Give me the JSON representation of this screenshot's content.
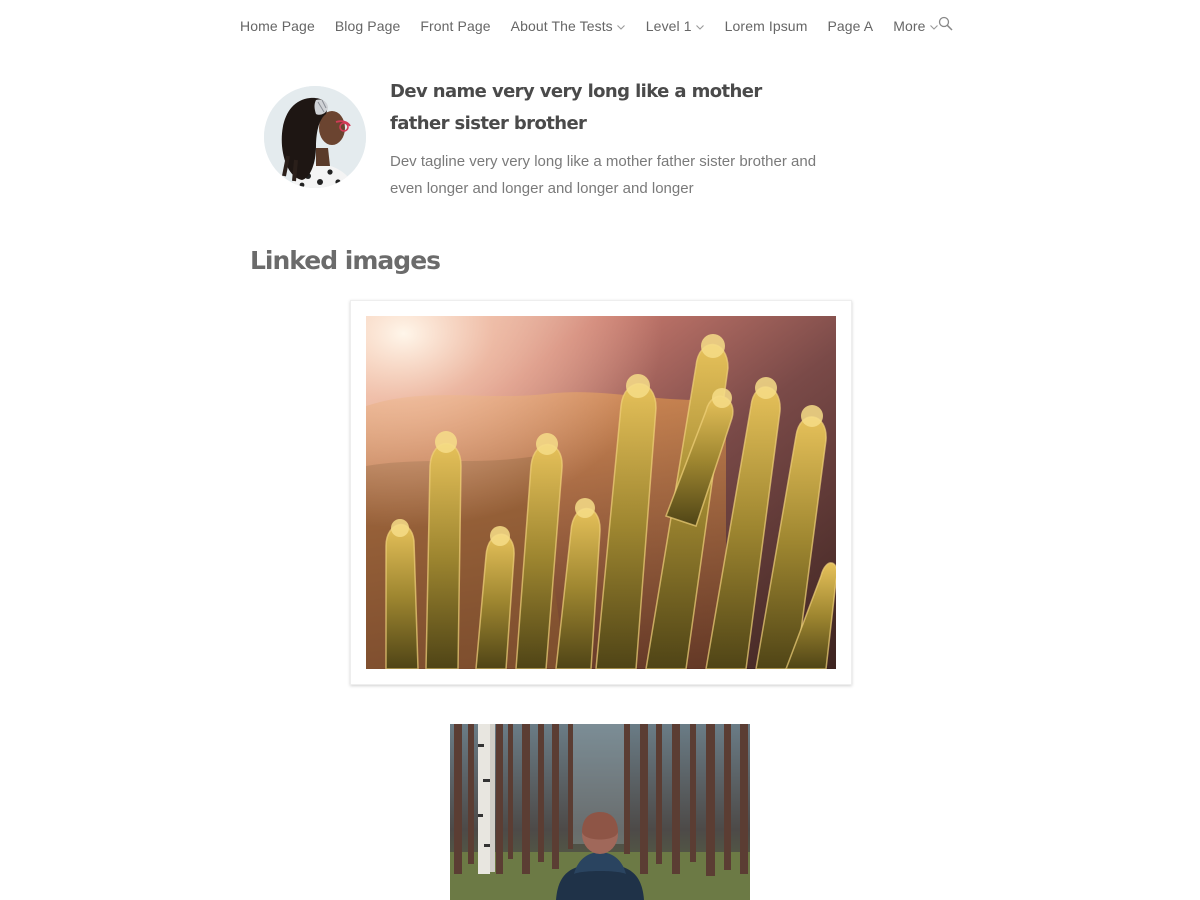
{
  "nav": {
    "items": [
      {
        "label": "Home Page",
        "has_dropdown": false
      },
      {
        "label": "Blog Page",
        "has_dropdown": false
      },
      {
        "label": "Front Page",
        "has_dropdown": false
      },
      {
        "label": "About The Tests",
        "has_dropdown": true
      },
      {
        "label": "Level 1",
        "has_dropdown": true
      },
      {
        "label": "Lorem Ipsum",
        "has_dropdown": false
      },
      {
        "label": "Page A",
        "has_dropdown": false
      },
      {
        "label": "More",
        "has_dropdown": true
      }
    ],
    "search_icon": "search-icon",
    "dropdown_icon": "chevron-down-icon"
  },
  "profile": {
    "name": "Dev name very very long like a mother father sister brother",
    "tagline": "Dev tagline very very long like a mother father sister brother and even longer and longer and longer and longer"
  },
  "section": {
    "title": "Linked images"
  },
  "colors": {
    "nav_text": "#666666",
    "heading": "#4a4a4a",
    "muted_text": "#7a7a7a",
    "section_heading": "#6b6b6b",
    "background": "#ffffff"
  }
}
